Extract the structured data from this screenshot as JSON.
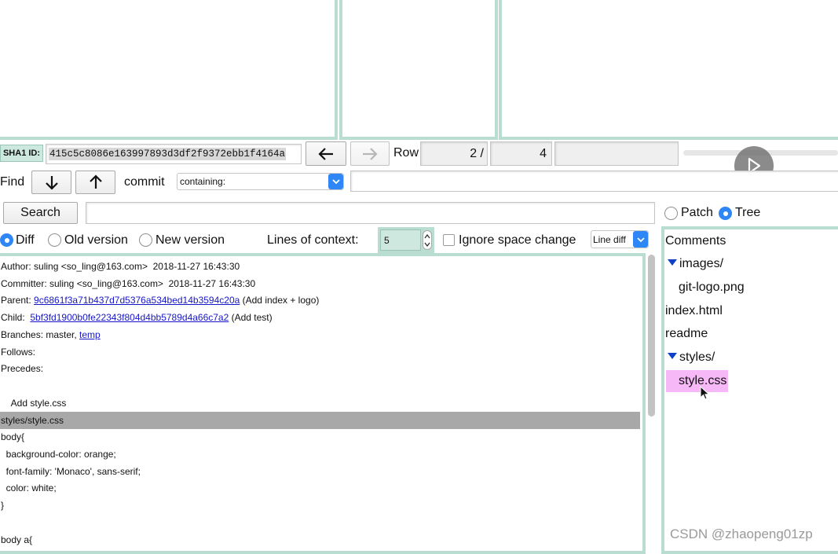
{
  "sha1": {
    "label": "SHA1 ID:",
    "value": "415c5c8086e163997893d3df2f9372ebb1f4164a"
  },
  "row": {
    "label": "Row",
    "current": "2 /",
    "total": "4"
  },
  "find": {
    "label": "Find",
    "commit_label": "commit",
    "mode": "containing:"
  },
  "search": {
    "label": "Search"
  },
  "view_mode": {
    "patch": "Patch",
    "tree": "Tree",
    "selected": "Tree"
  },
  "diff_options": {
    "diff": "Diff",
    "old_version": "Old version",
    "new_version": "New version",
    "selected": "Diff",
    "context_label": "Lines of context:",
    "context_value": "5",
    "ignore_space": "Ignore space change",
    "diff_mode": "Line diff"
  },
  "commit_details": {
    "author": "Author: suling <so_ling@163.com>  2018-11-27 16:43:30",
    "committer": "Committer: suling <so_ling@163.com>  2018-11-27 16:43:30",
    "parent_label": "Parent: ",
    "parent_sha": "9c6861f3a71b437d7d5376a534bed14b3594c20a",
    "parent_msg": " (Add index + logo)",
    "child_label": "Child:  ",
    "child_sha": "5bf3fd1900b0fe22343f804d4bb5789d4a66c7a2",
    "child_msg": " (Add test)",
    "branches_label": "Branches: master, ",
    "branches_link": "temp",
    "follows": "Follows:",
    "precedes": "Precedes:",
    "message": "    Add style.css",
    "file_header": "styles/style.css",
    "lines": [
      "body{",
      "  background-color: orange;",
      "  font-family: 'Monaco', sans-serif;",
      "  color: white;",
      "}",
      "",
      "body a{"
    ]
  },
  "tree": {
    "items": [
      {
        "label": "Comments",
        "indent": 0,
        "folder": false,
        "selected": false
      },
      {
        "label": "images/",
        "indent": 0,
        "folder": true,
        "selected": false
      },
      {
        "label": "git-logo.png",
        "indent": 1,
        "folder": false,
        "selected": false
      },
      {
        "label": "index.html",
        "indent": 0,
        "folder": false,
        "selected": false
      },
      {
        "label": "readme",
        "indent": 0,
        "folder": false,
        "selected": false
      },
      {
        "label": "styles/",
        "indent": 0,
        "folder": true,
        "selected": false
      },
      {
        "label": "style.css",
        "indent": 1,
        "folder": false,
        "selected": true
      }
    ]
  },
  "watermark": "CSDN @zhaopeng01zp",
  "colors": {
    "pane_border": "#b9ddd1",
    "link": "#1616c8",
    "selection": "#f6b8f6",
    "diff_header": "#a8a8a8",
    "accent": "#2f86f6"
  }
}
